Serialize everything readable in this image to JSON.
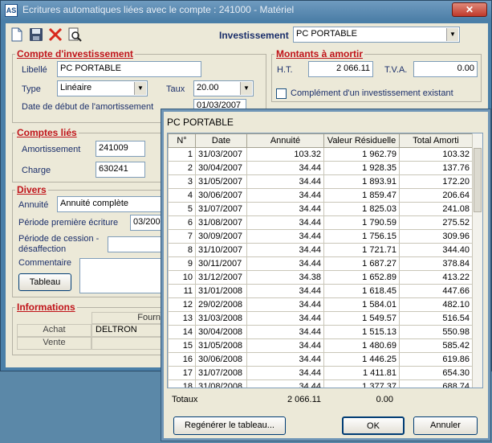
{
  "window": {
    "title": "Ecritures automatiques liées avec le compte : 241000 - Matériel",
    "close_glyph": "✕"
  },
  "toolbar": {
    "investissement_label": "Investissement",
    "investissement_value": "PC PORTABLE"
  },
  "compte": {
    "title": "Compte d'investissement",
    "libelle_label": "Libellé",
    "libelle_value": "PC PORTABLE",
    "type_label": "Type",
    "type_value": "Linéaire",
    "taux_label": "Taux",
    "taux_value": "20.00",
    "date_label": "Date de début de l'amortissement",
    "date_value": "01/03/2007"
  },
  "montants": {
    "title": "Montants à amortir",
    "ht_label": "H.T.",
    "ht_value": "2 066.11",
    "tva_label": "T.V.A.",
    "tva_value": "0.00",
    "complement_label": "Complément d'un investissement existant"
  },
  "comptes_lies": {
    "title": "Comptes liés",
    "amortissement_label": "Amortissement",
    "amortissement_value": "241009",
    "charge_label": "Charge",
    "charge_value": "630241"
  },
  "divers": {
    "title": "Divers",
    "annuite_label": "Annuité",
    "annuite_value": "Annuité complète",
    "periode_premiere_label": "Période première écriture",
    "periode_premiere_value": "03/2007",
    "periode_cession_label": "Période de cession - désaffection",
    "commentaire_label": "Commentaire",
    "tableau_button": "Tableau"
  },
  "informations": {
    "title": "Informations",
    "col_fournisseur": "Fourn",
    "row_achat": "Achat",
    "row_achat_value": "DELTRON",
    "row_vente": "Vente"
  },
  "dialog": {
    "title": "PC PORTABLE",
    "columns": [
      "N°",
      "Date",
      "Annuité",
      "Valeur Résiduelle",
      "Total Amorti"
    ],
    "rows": [
      [
        "1",
        "31/03/2007",
        "103.32",
        "1 962.79",
        "103.32"
      ],
      [
        "2",
        "30/04/2007",
        "34.44",
        "1 928.35",
        "137.76"
      ],
      [
        "3",
        "31/05/2007",
        "34.44",
        "1 893.91",
        "172.20"
      ],
      [
        "4",
        "30/06/2007",
        "34.44",
        "1 859.47",
        "206.64"
      ],
      [
        "5",
        "31/07/2007",
        "34.44",
        "1 825.03",
        "241.08"
      ],
      [
        "6",
        "31/08/2007",
        "34.44",
        "1 790.59",
        "275.52"
      ],
      [
        "7",
        "30/09/2007",
        "34.44",
        "1 756.15",
        "309.96"
      ],
      [
        "8",
        "31/10/2007",
        "34.44",
        "1 721.71",
        "344.40"
      ],
      [
        "9",
        "30/11/2007",
        "34.44",
        "1 687.27",
        "378.84"
      ],
      [
        "10",
        "31/12/2007",
        "34.38",
        "1 652.89",
        "413.22"
      ],
      [
        "11",
        "31/01/2008",
        "34.44",
        "1 618.45",
        "447.66"
      ],
      [
        "12",
        "29/02/2008",
        "34.44",
        "1 584.01",
        "482.10"
      ],
      [
        "13",
        "31/03/2008",
        "34.44",
        "1 549.57",
        "516.54"
      ],
      [
        "14",
        "30/04/2008",
        "34.44",
        "1 515.13",
        "550.98"
      ],
      [
        "15",
        "31/05/2008",
        "34.44",
        "1 480.69",
        "585.42"
      ],
      [
        "16",
        "30/06/2008",
        "34.44",
        "1 446.25",
        "619.86"
      ],
      [
        "17",
        "31/07/2008",
        "34.44",
        "1 411.81",
        "654.30"
      ],
      [
        "18",
        "31/08/2008",
        "34.44",
        "1 377.37",
        "688.74"
      ]
    ],
    "totaux_label": "Totaux",
    "totaux_annuite": "2 066.11",
    "totaux_residuelle": "0.00",
    "regenerer_button": "Regénérer le tableau...",
    "ok_button": "OK",
    "annuler_button": "Annuler"
  }
}
